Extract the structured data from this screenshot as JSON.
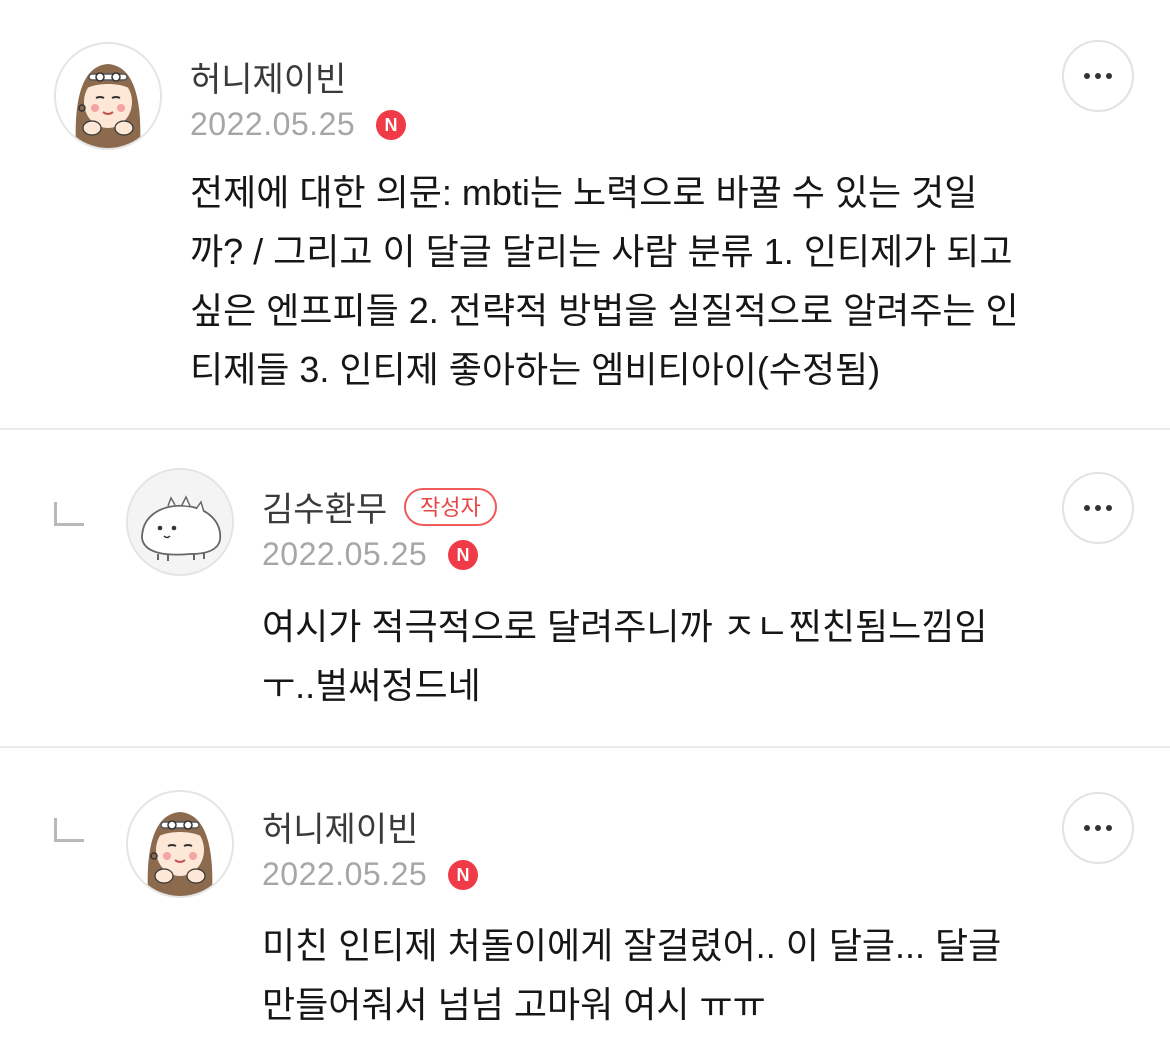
{
  "comments": [
    {
      "author": "허니제이빈",
      "date": "2022.05.25",
      "new_badge": "N",
      "text": "전제에 대한 의문: mbti는 노력으로 바꿀 수 있는 것일\n까? / 그리고 이 달글 달리는 사람 분류 1. 인티제가 되고\n싶은 엔프피들 2. 전략적 방법을 실질적으로 알려주는 인\n티제들 3. 인티제 좋아하는 엠비티아이(수정됨)",
      "more_icon": "more-horizontal-icon"
    },
    {
      "author": "김수환무",
      "author_badge": "작성자",
      "date": "2022.05.25",
      "new_badge": "N",
      "text": "여시가 적극적으로 달려주니까 ㅈㄴ찐친됨느낌임\nㅜ..벌써정드네",
      "reply_icon": "reply-arrow-icon",
      "more_icon": "more-horizontal-icon"
    },
    {
      "author": "허니제이빈",
      "date": "2022.05.25",
      "new_badge": "N",
      "text": "미친 인티제 처돌이에게 잘걸렸어.. 이 달글... 달글\n만들어줘서 넘넘 고마워 여시 ㅠㅠ",
      "reply_icon": "reply-arrow-icon",
      "more_icon": "more-horizontal-icon"
    }
  ],
  "colors": {
    "new_badge": "#f03a47",
    "author_badge": "#e84545",
    "date": "#a6a6a6",
    "divider": "#ececec"
  }
}
